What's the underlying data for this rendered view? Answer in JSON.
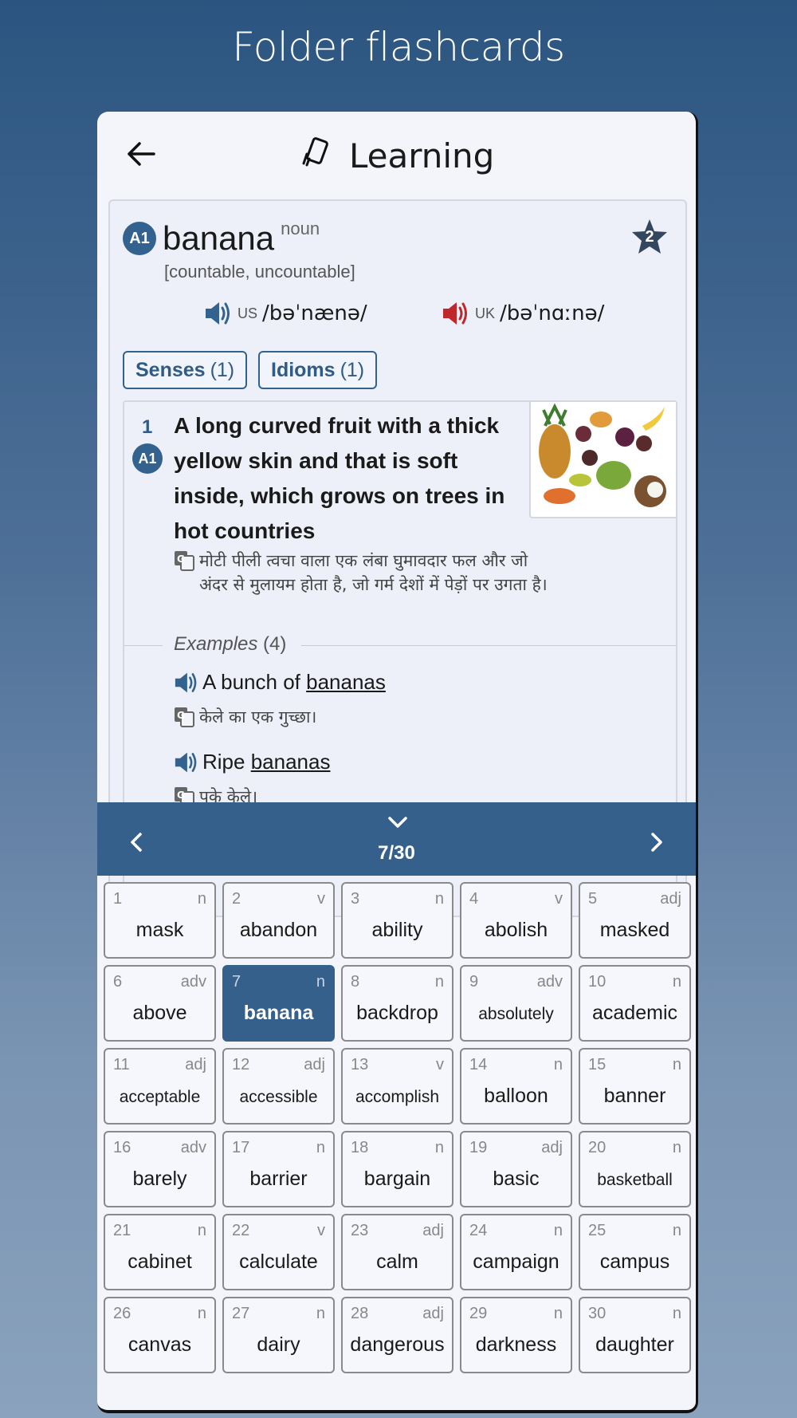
{
  "page": {
    "title": "Folder flashcards"
  },
  "appbar": {
    "title": "Learning",
    "back_icon": "arrow-left-icon",
    "title_icon": "cards-icon"
  },
  "entry": {
    "level": "A1",
    "word": "banana",
    "pos": "noun",
    "grammar": "[countable, uncountable]",
    "star_count": "2",
    "pron_us": {
      "tag": "US",
      "ipa": "/bəˈnænə/",
      "color": "#33628f"
    },
    "pron_uk": {
      "tag": "UK",
      "ipa": "/bəˈnɑːnə/",
      "color": "#c0272d"
    },
    "tabs": [
      {
        "label": "Senses",
        "count": "(1)"
      },
      {
        "label": "Idioms",
        "count": "(1)"
      }
    ],
    "sense": {
      "number": "1",
      "level": "A1",
      "definition": "A long curved fruit with a thick yellow skin and that is soft inside, which grows on trees in hot countries",
      "translation": "मोटी पीली त्वचा वाला एक लंबा घुमावदार फल और जो अंदर से मुलायम होता है, जो गर्म देशों में पेड़ों पर उगता है।",
      "examples_label": "Examples",
      "examples_count": "(4)",
      "examples": [
        {
          "before": "A bunch of ",
          "keyword": "bananas",
          "translation": "केले का एक गुच्छा।"
        },
        {
          "before": "Ripe ",
          "keyword": "bananas",
          "translation": "पके केले।"
        }
      ]
    }
  },
  "nav": {
    "counter": "7/30"
  },
  "words": [
    {
      "n": "1",
      "pos": "n",
      "w": "mask"
    },
    {
      "n": "2",
      "pos": "v",
      "w": "abandon"
    },
    {
      "n": "3",
      "pos": "n",
      "w": "ability"
    },
    {
      "n": "4",
      "pos": "v",
      "w": "abolish"
    },
    {
      "n": "5",
      "pos": "adj",
      "w": "masked"
    },
    {
      "n": "6",
      "pos": "adv",
      "w": "above"
    },
    {
      "n": "7",
      "pos": "n",
      "w": "banana"
    },
    {
      "n": "8",
      "pos": "n",
      "w": "backdrop"
    },
    {
      "n": "9",
      "pos": "adv",
      "w": "absolutely"
    },
    {
      "n": "10",
      "pos": "n",
      "w": "academic"
    },
    {
      "n": "11",
      "pos": "adj",
      "w": "acceptable"
    },
    {
      "n": "12",
      "pos": "adj",
      "w": "accessible"
    },
    {
      "n": "13",
      "pos": "v",
      "w": "accomplish"
    },
    {
      "n": "14",
      "pos": "n",
      "w": "balloon"
    },
    {
      "n": "15",
      "pos": "n",
      "w": "banner"
    },
    {
      "n": "16",
      "pos": "adv",
      "w": "barely"
    },
    {
      "n": "17",
      "pos": "n",
      "w": "barrier"
    },
    {
      "n": "18",
      "pos": "n",
      "w": "bargain"
    },
    {
      "n": "19",
      "pos": "adj",
      "w": "basic"
    },
    {
      "n": "20",
      "pos": "n",
      "w": "basketball"
    },
    {
      "n": "21",
      "pos": "n",
      "w": "cabinet"
    },
    {
      "n": "22",
      "pos": "v",
      "w": "calculate"
    },
    {
      "n": "23",
      "pos": "adj",
      "w": "calm"
    },
    {
      "n": "24",
      "pos": "n",
      "w": "campaign"
    },
    {
      "n": "25",
      "pos": "n",
      "w": "campus"
    },
    {
      "n": "26",
      "pos": "n",
      "w": "canvas"
    },
    {
      "n": "27",
      "pos": "n",
      "w": "dairy"
    },
    {
      "n": "28",
      "pos": "adj",
      "w": "dangerous"
    },
    {
      "n": "29",
      "pos": "n",
      "w": "darkness"
    },
    {
      "n": "30",
      "pos": "n",
      "w": "daughter"
    }
  ],
  "active_index": 6,
  "colors": {
    "primary": "#35608c",
    "uk_speaker": "#c0272d"
  }
}
